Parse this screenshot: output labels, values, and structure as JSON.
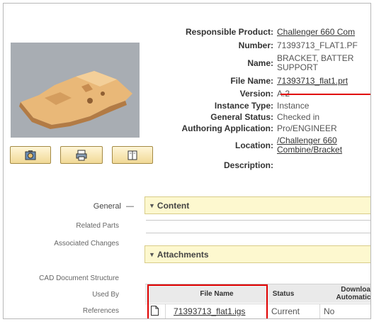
{
  "attributes": [
    {
      "label": "Responsible Product:",
      "value": "Challenger 660 Com",
      "link": true
    },
    {
      "label": "Number:",
      "value": "71393713_FLAT1.PF",
      "link": false
    },
    {
      "label": "Name:",
      "value": "BRACKET, BATTER SUPPORT",
      "link": false
    },
    {
      "label": "File Name:",
      "value": "71393713_flat1.prt",
      "link": true
    },
    {
      "label": "Version:",
      "value": "A.2",
      "link": false
    },
    {
      "label": "Instance Type:",
      "value": "Instance",
      "link": false
    },
    {
      "label": "General Status:",
      "value": "Checked in",
      "link": false
    },
    {
      "label": "Authoring Application:",
      "value": "Pro/ENGINEER",
      "link": false
    },
    {
      "label": "Location:",
      "value": "/Challenger 660 Combine/Bracket",
      "link": true
    },
    {
      "label": "Description:",
      "value": "",
      "link": false
    }
  ],
  "buttons": [
    {
      "icon": "view-3d-icon"
    },
    {
      "icon": "print-icon"
    },
    {
      "icon": "book-icon"
    }
  ],
  "nav": {
    "general": "General",
    "general_dash": "—",
    "related_parts": "Related Parts",
    "associated_changes": "Associated Changes",
    "cad_structure": "CAD Document Structure",
    "used_by": "Used By",
    "references": "References"
  },
  "sections": {
    "content": "Content",
    "attachments": "Attachments"
  },
  "attachments": {
    "columns": {
      "file_name": "File Name",
      "status": "Status",
      "download": "Download Automatica"
    },
    "rows": [
      {
        "file_name": "71393713_flat1.igs",
        "status": "Current",
        "download": "No"
      }
    ]
  },
  "colors": {
    "highlight": "#e00000",
    "section_bg": "#fdf8cf",
    "button_bg": "#f1d996"
  }
}
